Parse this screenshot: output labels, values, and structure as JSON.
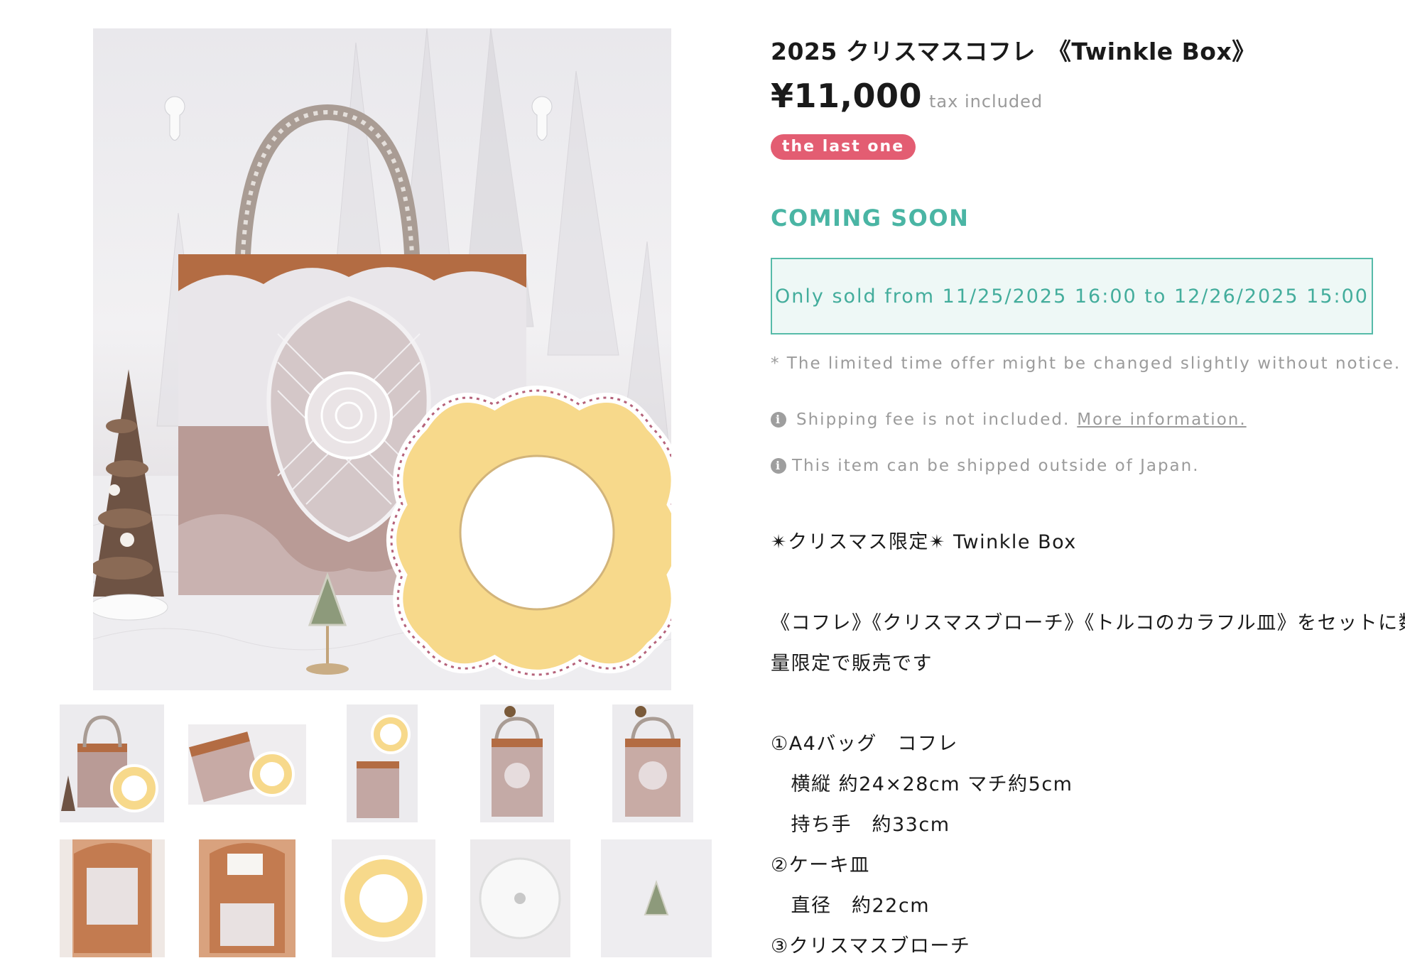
{
  "product": {
    "title": "2025 クリスマスコフレ　《Twinkle Box》",
    "price": "¥11,000",
    "tax_note": "tax included",
    "stock_badge": "the last one",
    "status": "COMING SOON",
    "sale_period": "Only sold from 11/25/2025 16:00 to 12/26/2025 15:00",
    "notice": "* The limited time offer might be changed slightly without notice.",
    "shipping_note": "Shipping fee is not included.",
    "shipping_link": "More information.",
    "overseas_note": "This item can be shipped outside of Japan."
  },
  "description": {
    "line1": "✴クリスマス限定✴ Twinkle Box",
    "line2": "《コフレ》《クリスマスブローチ》《トルコのカラフル皿》をセットに数",
    "line3": "量限定で販売です",
    "line4": "①A4バッグ　コフレ",
    "line5": "　横縦 約24×28cm マチ約5cm",
    "line6": "　持ち手　約33cm",
    "line7": "②ケーキ皿",
    "line8": "　直径　約22cm",
    "line9": "③クリスマスブローチ"
  },
  "icons": {
    "info": "info-icon",
    "info_glyph": "i"
  },
  "colors": {
    "accent": "#4ab5a4",
    "badge": "#e35d72",
    "sale_box_bg": "#eef8f6",
    "muted_text": "#9b9b9b"
  }
}
